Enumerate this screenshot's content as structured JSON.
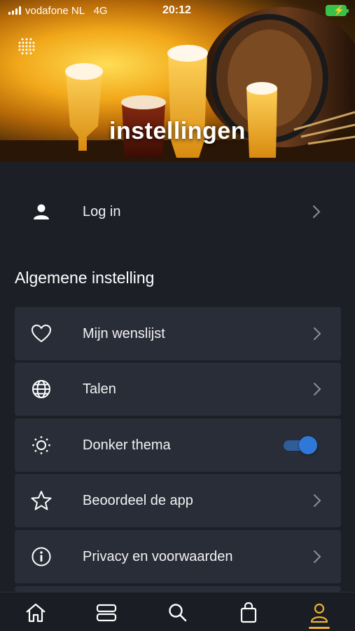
{
  "status_bar": {
    "carrier": "vodafone NL",
    "network": "4G",
    "time": "20:12"
  },
  "header": {
    "title": "instellingen"
  },
  "account": {
    "login_label": "Log in"
  },
  "general": {
    "section_title": "Algemene instelling",
    "items": [
      {
        "label": "Mijn wenslijst",
        "icon": "heart-icon"
      },
      {
        "label": "Talen",
        "icon": "globe-icon"
      },
      {
        "label": "Donker thema",
        "icon": "sun-icon",
        "toggle_on": true
      },
      {
        "label": "Beoordeel de app",
        "icon": "star-icon"
      },
      {
        "label": "Privacy en voorwaarden",
        "icon": "info-icon"
      }
    ]
  },
  "bottom_nav": {
    "items": [
      "home-icon",
      "categories-icon",
      "search-icon",
      "bag-icon",
      "profile-icon"
    ],
    "active": "profile-icon",
    "active_color": "#f2b233"
  },
  "colors": {
    "background": "#1c1f26",
    "card": "#292d38",
    "toggle_accent": "#2f78d9"
  }
}
